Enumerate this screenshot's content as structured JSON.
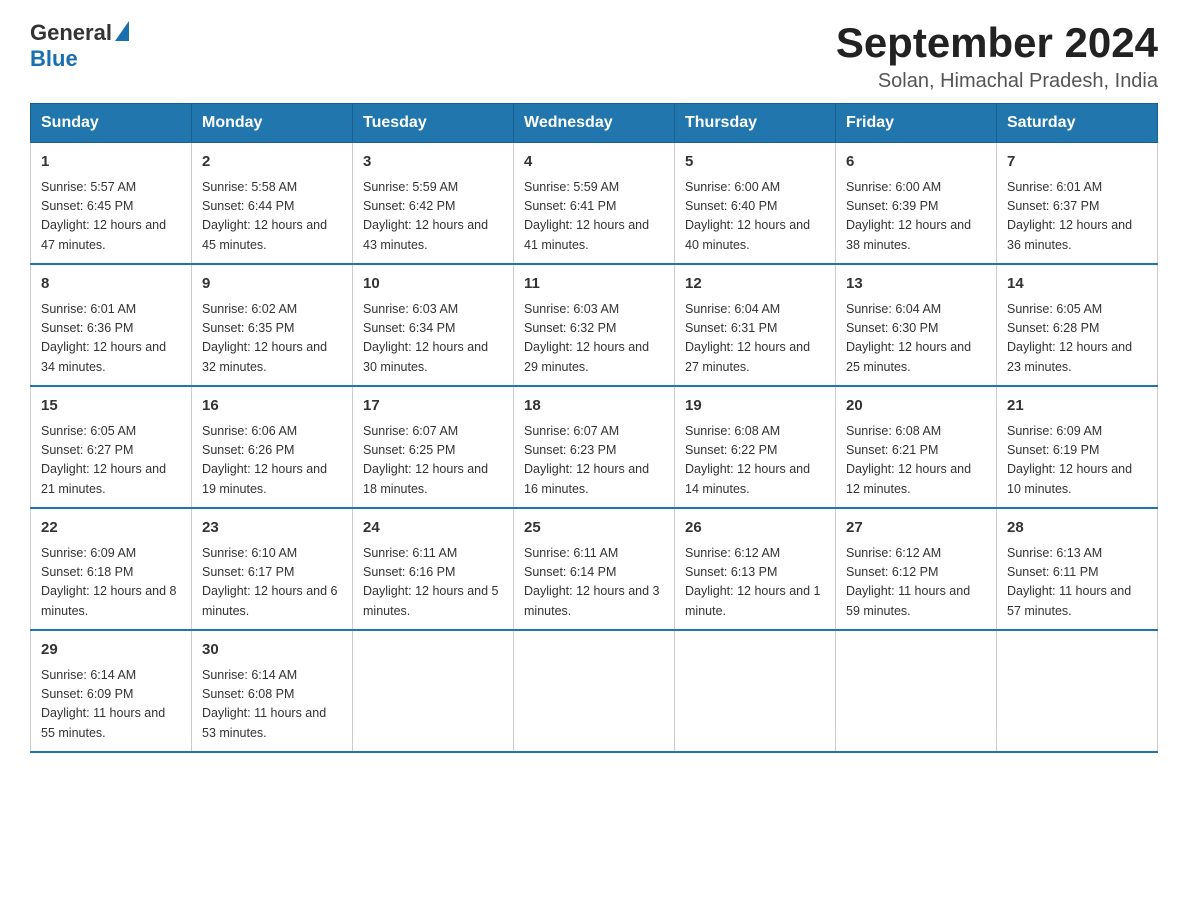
{
  "header": {
    "logo_general": "General",
    "logo_blue": "Blue",
    "title": "September 2024",
    "subtitle": "Solan, Himachal Pradesh, India"
  },
  "calendar": {
    "columns": [
      "Sunday",
      "Monday",
      "Tuesday",
      "Wednesday",
      "Thursday",
      "Friday",
      "Saturday"
    ],
    "weeks": [
      [
        {
          "day": "1",
          "sunrise": "5:57 AM",
          "sunset": "6:45 PM",
          "daylight": "12 hours and 47 minutes."
        },
        {
          "day": "2",
          "sunrise": "5:58 AM",
          "sunset": "6:44 PM",
          "daylight": "12 hours and 45 minutes."
        },
        {
          "day": "3",
          "sunrise": "5:59 AM",
          "sunset": "6:42 PM",
          "daylight": "12 hours and 43 minutes."
        },
        {
          "day": "4",
          "sunrise": "5:59 AM",
          "sunset": "6:41 PM",
          "daylight": "12 hours and 41 minutes."
        },
        {
          "day": "5",
          "sunrise": "6:00 AM",
          "sunset": "6:40 PM",
          "daylight": "12 hours and 40 minutes."
        },
        {
          "day": "6",
          "sunrise": "6:00 AM",
          "sunset": "6:39 PM",
          "daylight": "12 hours and 38 minutes."
        },
        {
          "day": "7",
          "sunrise": "6:01 AM",
          "sunset": "6:37 PM",
          "daylight": "12 hours and 36 minutes."
        }
      ],
      [
        {
          "day": "8",
          "sunrise": "6:01 AM",
          "sunset": "6:36 PM",
          "daylight": "12 hours and 34 minutes."
        },
        {
          "day": "9",
          "sunrise": "6:02 AM",
          "sunset": "6:35 PM",
          "daylight": "12 hours and 32 minutes."
        },
        {
          "day": "10",
          "sunrise": "6:03 AM",
          "sunset": "6:34 PM",
          "daylight": "12 hours and 30 minutes."
        },
        {
          "day": "11",
          "sunrise": "6:03 AM",
          "sunset": "6:32 PM",
          "daylight": "12 hours and 29 minutes."
        },
        {
          "day": "12",
          "sunrise": "6:04 AM",
          "sunset": "6:31 PM",
          "daylight": "12 hours and 27 minutes."
        },
        {
          "day": "13",
          "sunrise": "6:04 AM",
          "sunset": "6:30 PM",
          "daylight": "12 hours and 25 minutes."
        },
        {
          "day": "14",
          "sunrise": "6:05 AM",
          "sunset": "6:28 PM",
          "daylight": "12 hours and 23 minutes."
        }
      ],
      [
        {
          "day": "15",
          "sunrise": "6:05 AM",
          "sunset": "6:27 PM",
          "daylight": "12 hours and 21 minutes."
        },
        {
          "day": "16",
          "sunrise": "6:06 AM",
          "sunset": "6:26 PM",
          "daylight": "12 hours and 19 minutes."
        },
        {
          "day": "17",
          "sunrise": "6:07 AM",
          "sunset": "6:25 PM",
          "daylight": "12 hours and 18 minutes."
        },
        {
          "day": "18",
          "sunrise": "6:07 AM",
          "sunset": "6:23 PM",
          "daylight": "12 hours and 16 minutes."
        },
        {
          "day": "19",
          "sunrise": "6:08 AM",
          "sunset": "6:22 PM",
          "daylight": "12 hours and 14 minutes."
        },
        {
          "day": "20",
          "sunrise": "6:08 AM",
          "sunset": "6:21 PM",
          "daylight": "12 hours and 12 minutes."
        },
        {
          "day": "21",
          "sunrise": "6:09 AM",
          "sunset": "6:19 PM",
          "daylight": "12 hours and 10 minutes."
        }
      ],
      [
        {
          "day": "22",
          "sunrise": "6:09 AM",
          "sunset": "6:18 PM",
          "daylight": "12 hours and 8 minutes."
        },
        {
          "day": "23",
          "sunrise": "6:10 AM",
          "sunset": "6:17 PM",
          "daylight": "12 hours and 6 minutes."
        },
        {
          "day": "24",
          "sunrise": "6:11 AM",
          "sunset": "6:16 PM",
          "daylight": "12 hours and 5 minutes."
        },
        {
          "day": "25",
          "sunrise": "6:11 AM",
          "sunset": "6:14 PM",
          "daylight": "12 hours and 3 minutes."
        },
        {
          "day": "26",
          "sunrise": "6:12 AM",
          "sunset": "6:13 PM",
          "daylight": "12 hours and 1 minute."
        },
        {
          "day": "27",
          "sunrise": "6:12 AM",
          "sunset": "6:12 PM",
          "daylight": "11 hours and 59 minutes."
        },
        {
          "day": "28",
          "sunrise": "6:13 AM",
          "sunset": "6:11 PM",
          "daylight": "11 hours and 57 minutes."
        }
      ],
      [
        {
          "day": "29",
          "sunrise": "6:14 AM",
          "sunset": "6:09 PM",
          "daylight": "11 hours and 55 minutes."
        },
        {
          "day": "30",
          "sunrise": "6:14 AM",
          "sunset": "6:08 PM",
          "daylight": "11 hours and 53 minutes."
        },
        null,
        null,
        null,
        null,
        null
      ]
    ],
    "labels": {
      "sunrise": "Sunrise: ",
      "sunset": "Sunset: ",
      "daylight": "Daylight: "
    }
  }
}
